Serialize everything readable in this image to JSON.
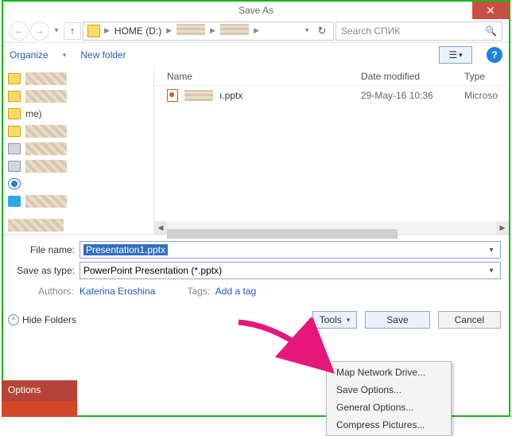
{
  "titlebar": {
    "title": "Save As"
  },
  "breadcrumb": {
    "seg1": "HOME (D:)"
  },
  "search": {
    "placeholder": "Search СПИК"
  },
  "toolbar": {
    "organize": "Organize",
    "newfolder": "New folder"
  },
  "sidebar": {
    "me": "me)"
  },
  "files": {
    "headers": {
      "name": "Name",
      "date": "Date modified",
      "type": "Type"
    },
    "rows": [
      {
        "name": "ı.pptx",
        "date": "29-May-16 10:36",
        "type": "Microso"
      }
    ]
  },
  "form": {
    "filename_label": "File name:",
    "filename_value": "Presentation1.pptx",
    "type_label": "Save as type:",
    "type_value": "PowerPoint Presentation (*.pptx)",
    "authors_label": "Authors:",
    "authors_value": "Katerina Eroshina",
    "tags_label": "Tags:",
    "tags_value": "Add a tag"
  },
  "footer": {
    "hidefolders": "Hide Folders",
    "tools": "Tools",
    "save": "Save",
    "cancel": "Cancel"
  },
  "menu": [
    "Map Network Drive...",
    "Save Options...",
    "General Options...",
    "Compress Pictures..."
  ],
  "backdrop": {
    "options": "Options"
  }
}
